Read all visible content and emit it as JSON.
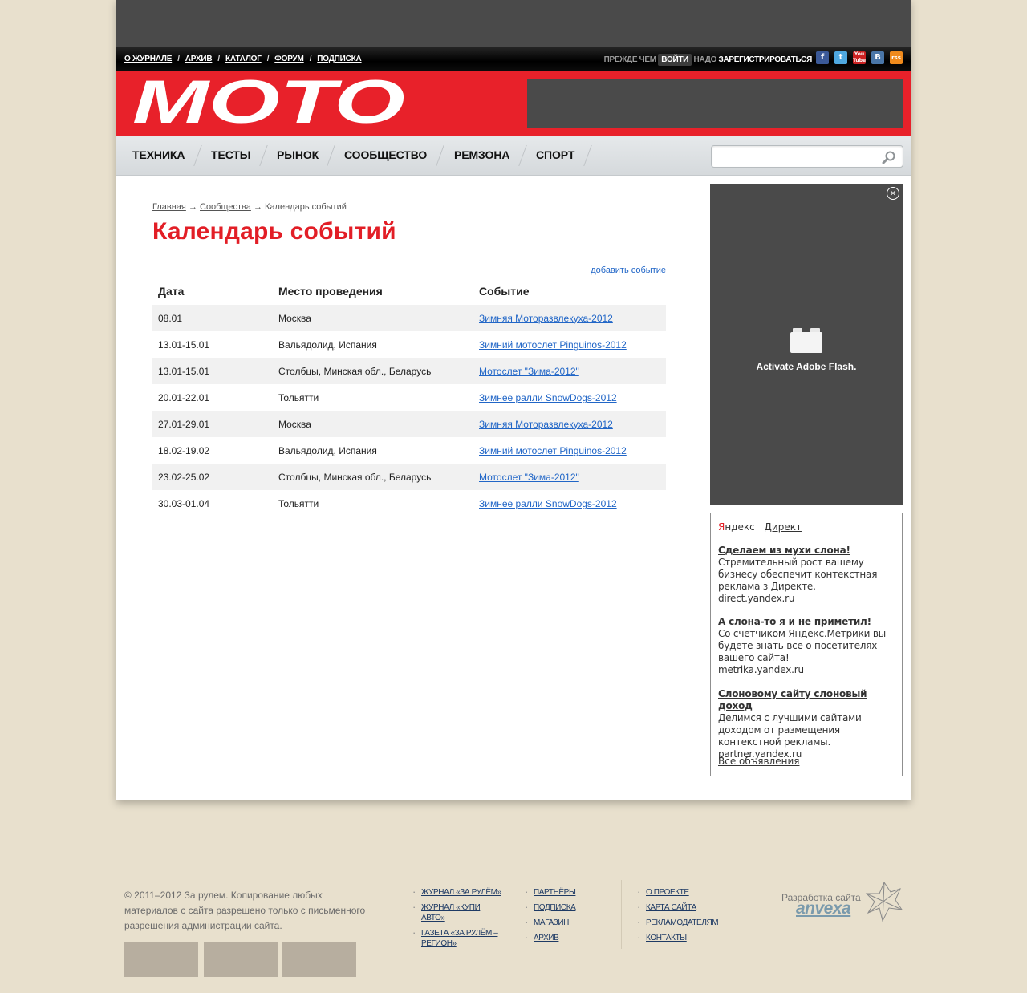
{
  "topnav": {
    "items": [
      "О ЖУРНАЛЕ",
      "АРХИВ",
      "КАТАЛОГ",
      "ФОРУМ",
      "ПОДПИСКА"
    ],
    "separator": "/"
  },
  "auth": {
    "before": "ПРЕЖДЕ ЧЕМ",
    "login": "ВОЙТИ",
    "middle": "НАДО",
    "register": "ЗАРЕГИСТРИРОВАТЬСЯ"
  },
  "social": [
    {
      "icon": "facebook-icon",
      "glyph": "f",
      "color": "#3b5998"
    },
    {
      "icon": "twitter-icon",
      "glyph": "t",
      "color": "#4fa8e0"
    },
    {
      "icon": "youtube-icon",
      "glyph": "You Tube",
      "color": "#cc2222"
    },
    {
      "icon": "vkontakte-icon",
      "glyph": "В",
      "color": "#4a76a8"
    },
    {
      "icon": "rss-icon",
      "glyph": "rss",
      "color": "#f08a1c"
    }
  ],
  "brand": {
    "logo_text": "MOTO",
    "red": "#e8212a",
    "title_red": "#e21e26",
    "link_blue": "#2166c7"
  },
  "mainnav": {
    "items": [
      "ТЕХНИКА",
      "ТЕСТЫ",
      "РЫНОК",
      "СООБЩЕСТВО",
      "РЕМЗОНА",
      "СПОРТ"
    ],
    "search_placeholder": ""
  },
  "breadcrumb": {
    "home": "Главная",
    "arrow": "→",
    "section": "Сообщества",
    "current": "Календарь событий"
  },
  "page_title": "Календарь событий",
  "add_event": "добавить событие",
  "table": {
    "headers": [
      "Дата",
      "Место проведения",
      "Событие"
    ],
    "rows": [
      {
        "date": "08.01",
        "place": "Москва",
        "event": "Зимняя Моторазвлекуха-2012"
      },
      {
        "date": "13.01-15.01",
        "place": "Вальядолид, Испания",
        "event": "Зимний мотослет Pinguinos-2012"
      },
      {
        "date": "13.01-15.01",
        "place": "Столбцы, Минская обл., Беларусь",
        "event": "Мотослет \"Зима-2012\""
      },
      {
        "date": "20.01-22.01",
        "place": "Тольятти",
        "event": "Зимнее ралли SnowDogs-2012"
      },
      {
        "date": "27.01-29.01",
        "place": "Москва",
        "event": "Зимняя Моторазвлекуха-2012"
      },
      {
        "date": "18.02-19.02",
        "place": "Вальядолид, Испания",
        "event": "Зимний мотослет Pinguinos-2012"
      },
      {
        "date": "23.02-25.02",
        "place": "Столбцы, Минская обл., Беларусь",
        "event": "Мотослет \"Зима-2012\""
      },
      {
        "date": "30.03-01.04",
        "place": "Тольятти",
        "event": "Зимнее ралли SnowDogs-2012"
      }
    ]
  },
  "flash_ad": {
    "activate": "Activate Adobe Flash."
  },
  "yandex": {
    "ya_first": "Я",
    "ya_rest": "ндекс",
    "direkt": "Директ",
    "ads": [
      {
        "title": "Сделаем из мухи слона!",
        "text": "Стремительный рост вашему бизнесу обеспечит контекстная реклама з Директе.",
        "url": "direct.yandex.ru"
      },
      {
        "title": "А слона-то я и не приметил!",
        "text": "Со счетчиком Яндекс.Метрики вы будете знать все о посетителях вашего сайта!",
        "url": "metrika.yandex.ru"
      },
      {
        "title": "Слоновому сайту слоновый доход",
        "text": "Делимся с лучшими сайтами доходом от размещения контекстной рекламы.",
        "url": "partner.yandex.ru"
      }
    ],
    "all": "Все объявления"
  },
  "footer": {
    "copyright": "© 2011–2012 За рулем. Копирование любых материалов с сайта разрешено только с письменного разрешения администрации сайта.",
    "col1": [
      "ЖУРНАЛ «ЗА РУЛЁМ»",
      "ЖУРНАЛ «КУПИ АВТО»",
      "ГАЗЕТА «ЗА РУЛЁМ – РЕГИОН»"
    ],
    "col2": [
      "ПАРТНЁРЫ",
      "ПОДПИСКА",
      "МАГАЗИН",
      "АРХИВ"
    ],
    "col3": [
      "О ПРОЕКТЕ",
      "КАРТА САЙТА",
      "РЕКЛАМОДАТЕЛЯМ",
      "КОНТАКТЫ"
    ],
    "dev_label": "Разработка сайта",
    "dev_name": "anvexa"
  }
}
